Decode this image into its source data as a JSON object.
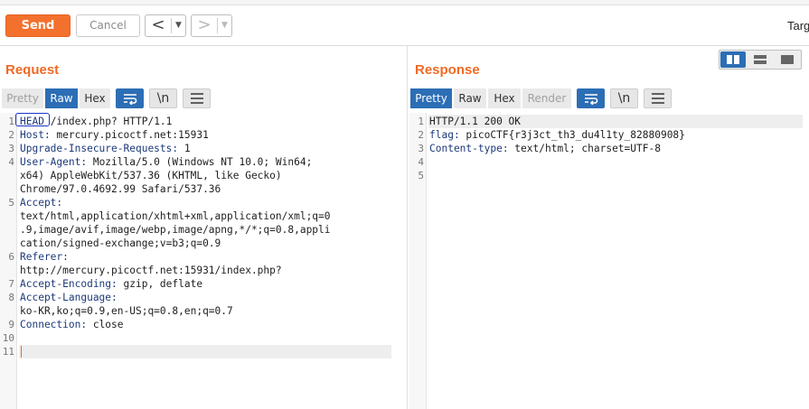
{
  "toolbar": {
    "send_label": "Send",
    "cancel_label": "Cancel",
    "back_arrow": "<",
    "forward_arrow": ">",
    "dropdown_glyph": "▼",
    "target_label": "Targ"
  },
  "request": {
    "title": "Request",
    "tabs": [
      {
        "label": "Pretty",
        "state": "muted"
      },
      {
        "label": "Raw",
        "state": "active"
      },
      {
        "label": "Hex",
        "state": "normal"
      }
    ],
    "icon_buttons": [
      "wrap-icon",
      "newline-icon",
      "menu-icon"
    ],
    "newline_label": "\\n",
    "line_numbers": [
      "1",
      "2",
      "3",
      "4",
      "",
      "",
      "5",
      "",
      "",
      "",
      "6",
      "",
      "7",
      "8",
      "",
      "9",
      "10",
      "11"
    ],
    "lines": [
      {
        "key": "HEAD",
        "rest": " /index.php? HTTP/1.1"
      },
      {
        "key": "Host:",
        "rest": " mercury.picoctf.net:15931"
      },
      {
        "key": "Upgrade-Insecure-Requests:",
        "rest": " 1"
      },
      {
        "key": "User-Agent:",
        "rest": " Mozilla/5.0 (Windows NT 10.0; Win64;"
      },
      {
        "key": "",
        "rest": "x64) AppleWebKit/537.36 (KHTML, like Gecko)"
      },
      {
        "key": "",
        "rest": "Chrome/97.0.4692.99 Safari/537.36"
      },
      {
        "key": "Accept:",
        "rest": ""
      },
      {
        "key": "",
        "rest": "text/html,application/xhtml+xml,application/xml;q=0"
      },
      {
        "key": "",
        "rest": ".9,image/avif,image/webp,image/apng,*/*;q=0.8,appli"
      },
      {
        "key": "",
        "rest": "cation/signed-exchange;v=b3;q=0.9"
      },
      {
        "key": "Referer:",
        "rest": ""
      },
      {
        "key": "",
        "rest": "http://mercury.picoctf.net:15931/index.php?"
      },
      {
        "key": "Accept-Encoding:",
        "rest": " gzip, deflate"
      },
      {
        "key": "Accept-Language:",
        "rest": ""
      },
      {
        "key": "",
        "rest": "ko-KR,ko;q=0.9,en-US;q=0.8,en;q=0.7"
      },
      {
        "key": "Connection:",
        "rest": " close"
      },
      {
        "key": "",
        "rest": ""
      },
      {
        "key": "",
        "rest": ""
      }
    ]
  },
  "response": {
    "title": "Response",
    "tabs": [
      {
        "label": "Pretty",
        "state": "active"
      },
      {
        "label": "Raw",
        "state": "normal"
      },
      {
        "label": "Hex",
        "state": "normal"
      },
      {
        "label": "Render",
        "state": "muted"
      }
    ],
    "newline_label": "\\n",
    "line_numbers": [
      "1",
      "2",
      "3",
      "4",
      "5"
    ],
    "lines": [
      {
        "key": "",
        "rest": "HTTP/1.1 200 OK"
      },
      {
        "key": "flag:",
        "rest": " picoCTF{r3j3ct_th3_du4l1ty_82880908}"
      },
      {
        "key": "Content-type:",
        "rest": " text/html; charset=UTF-8"
      },
      {
        "key": "",
        "rest": ""
      },
      {
        "key": "",
        "rest": ""
      }
    ]
  },
  "colors": {
    "accent_orange": "#f06a25",
    "tab_blue": "#2c6eb5",
    "header_key": "#1c3a7a",
    "annotation_circle": "#1a35c8"
  }
}
